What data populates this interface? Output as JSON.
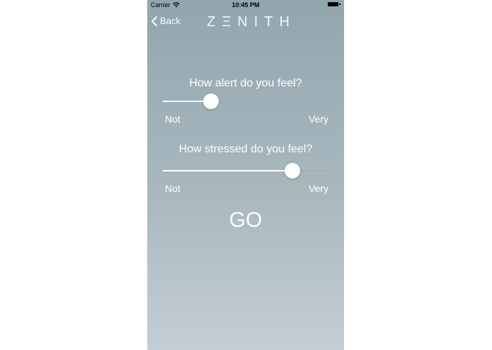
{
  "status_bar": {
    "carrier": "Carrier",
    "time": "10:45 PM"
  },
  "nav": {
    "back_label": "Back",
    "brand": "ZΞNITH"
  },
  "questions": [
    {
      "prompt": "How alert do you feel?",
      "min_label": "Not",
      "max_label": "Very",
      "value": 0.29
    },
    {
      "prompt": "How stressed do you feel?",
      "min_label": "Not",
      "max_label": "Very",
      "value": 0.78
    }
  ],
  "go_label": "GO",
  "colors": {
    "background_top": "#92a6ae",
    "background_bottom": "#c4ced4",
    "text": "#ffffff"
  }
}
